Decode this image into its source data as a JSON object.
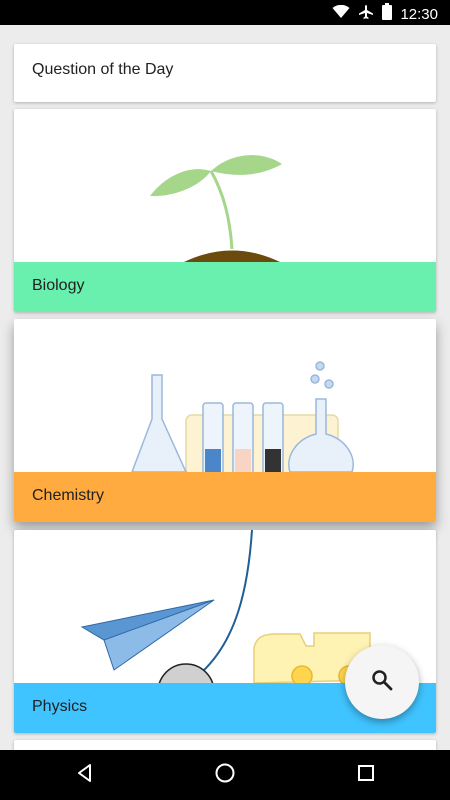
{
  "status_bar": {
    "time": "12:30",
    "icons": [
      "wifi-icon",
      "airplane-mode-icon",
      "battery-icon"
    ]
  },
  "cards": {
    "qotd": {
      "label": "Question of the Day"
    },
    "biology": {
      "label": "Biology",
      "color": "#69f0ae"
    },
    "chemistry": {
      "label": "Chemistry",
      "color": "#ffab40"
    },
    "physics": {
      "label": "Physics",
      "color": "#40c4ff"
    }
  },
  "fab": {
    "icon": "search-icon"
  },
  "nav_bar": {
    "icons": [
      "back-icon",
      "home-icon",
      "recents-icon"
    ]
  }
}
